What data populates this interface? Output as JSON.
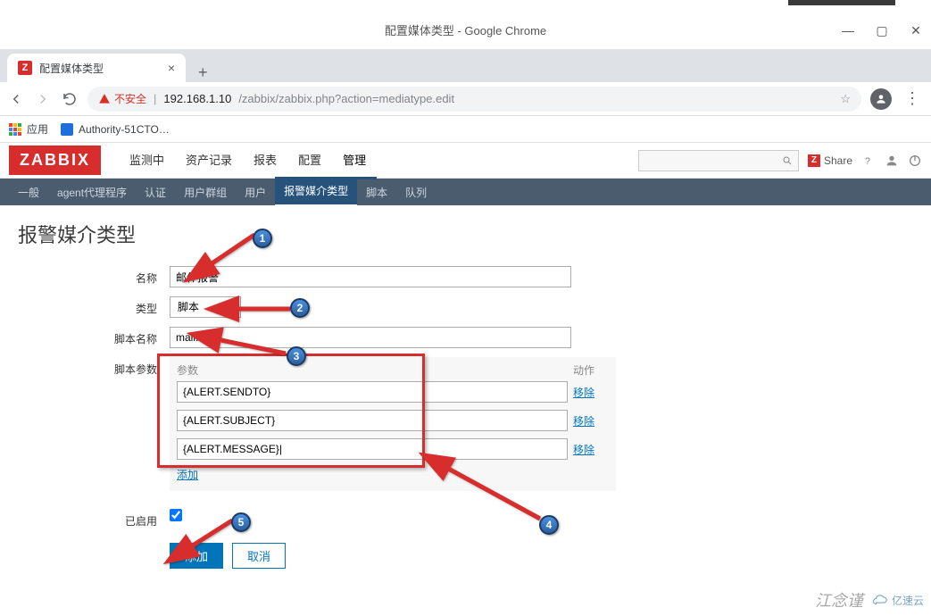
{
  "window": {
    "title": "配置媒体类型 - Google Chrome"
  },
  "tab": {
    "title": "配置媒体类型"
  },
  "addressbar": {
    "insecure_label": "不安全",
    "host": "192.168.1.10",
    "path": "/zabbix/zabbix.php?action=mediatype.edit"
  },
  "bookmarks": {
    "apps_label": "应用",
    "items": [
      "Authority-51CTO…"
    ]
  },
  "zabbix": {
    "logo": "ZABBIX",
    "menu": [
      "监测中",
      "资产记录",
      "报表",
      "配置",
      "管理"
    ],
    "menu_active_index": 4,
    "share_label": "Share",
    "submenu": [
      "一般",
      "agent代理程序",
      "认证",
      "用户群组",
      "用户",
      "报警媒介类型",
      "脚本",
      "队列"
    ],
    "submenu_active_index": 5,
    "page_title": "报警媒介类型"
  },
  "form": {
    "labels": {
      "name": "名称",
      "type": "类型",
      "script_name": "脚本名称",
      "script_params": "脚本参数",
      "enabled": "已启用"
    },
    "values": {
      "name": "邮件报警",
      "type": "脚本",
      "script_name": "mail.sh",
      "enabled": true
    },
    "params": {
      "header_param": "参数",
      "header_action": "动作",
      "rows": [
        "{ALERT.SENDTO}",
        "{ALERT.SUBJECT}",
        "{ALERT.MESSAGE}|"
      ],
      "remove_label": "移除",
      "add_label": "添加"
    },
    "buttons": {
      "submit": "添加",
      "cancel": "取消"
    }
  },
  "annotations": {
    "b1": "1",
    "b2": "2",
    "b3": "3",
    "b4": "4",
    "b5": "5"
  },
  "watermark": {
    "text": "江念谨",
    "brand": "亿速云"
  }
}
